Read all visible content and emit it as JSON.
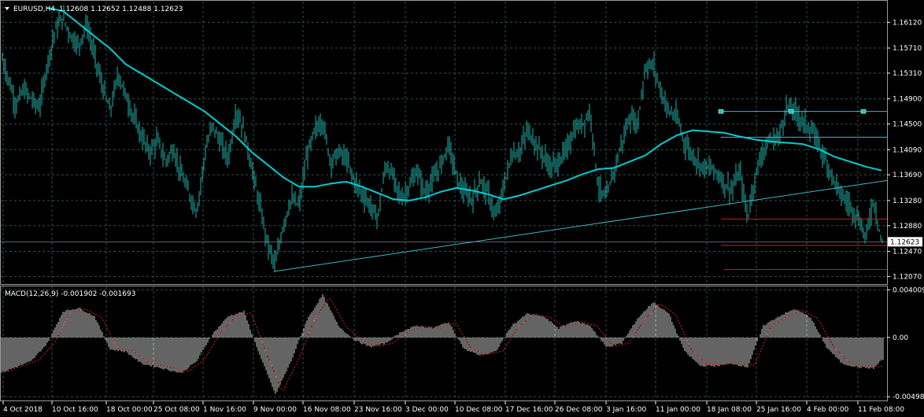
{
  "header": {
    "symbol": "EURUSD,H4",
    "ohlc": "1.12608 1.12652 1.12488 1.12623"
  },
  "macd_header": {
    "label": "MACD(12,26,9) -0.001902 -0.001693"
  },
  "colors": {
    "background": "#000000",
    "grid": "#2f4f4f",
    "bar": "#20b2aa",
    "ma": "#00ced1",
    "trendline": "#3fb7c7",
    "hline_red": "#c81e1e",
    "macd_hist": "#c8c8c8",
    "signal": "#e02020",
    "text": "#ffffff"
  },
  "chart_data": [
    {
      "type": "candlestick",
      "title": "EURUSD,H4",
      "y_ticks": [
        "1.16120",
        "1.15710",
        "1.15310",
        "1.14900",
        "1.14500",
        "1.14090",
        "1.13690",
        "1.13280",
        "1.12880",
        "1.12470",
        "1.12070"
      ],
      "ylim": [
        1.1195,
        1.1645
      ],
      "current_price": "1.12623",
      "x_ticks": [
        "4 Oct 2018",
        "10 Oct 16:00",
        "18 Oct 00:00",
        "25 Oct 08:00",
        "1 Nov 16:00",
        "9 Nov 00:00",
        "16 Nov 08:00",
        "23 Nov 16:00",
        "3 Dec 00:00",
        "10 Dec 08:00",
        "17 Dec 16:00",
        "26 Dec 08:00",
        "3 Jan 16:00",
        "11 Jan 00:00",
        "18 Jan 08:00",
        "25 Jan 16:00",
        "4 Feb 00:00",
        "11 Feb 08:00"
      ],
      "close_path": [
        [
          0,
          1.1565
        ],
        [
          10,
          1.1525
        ],
        [
          20,
          1.148
        ],
        [
          30,
          1.1505
        ],
        [
          40,
          1.149
        ],
        [
          50,
          1.1475
        ],
        [
          60,
          1.1545
        ],
        [
          70,
          1.16
        ],
        [
          80,
          1.162
        ],
        [
          90,
          1.159
        ],
        [
          100,
          1.1575
        ],
        [
          110,
          1.161
        ],
        [
          120,
          1.156
        ],
        [
          130,
          1.151
        ],
        [
          140,
          1.147
        ],
        [
          150,
          1.153
        ],
        [
          160,
          1.1495
        ],
        [
          170,
          1.146
        ],
        [
          180,
          1.143
        ],
        [
          190,
          1.1405
        ],
        [
          200,
          1.1425
        ],
        [
          210,
          1.139
        ],
        [
          220,
          1.141
        ],
        [
          230,
          1.137
        ],
        [
          240,
          1.134
        ],
        [
          250,
          1.131
        ],
        [
          260,
          1.14
        ],
        [
          270,
          1.145
        ],
        [
          280,
          1.142
        ],
        [
          290,
          1.1395
        ],
        [
          300,
          1.147
        ],
        [
          310,
          1.144
        ],
        [
          320,
          1.138
        ],
        [
          330,
          1.132
        ],
        [
          340,
          1.126
        ],
        [
          350,
          1.1225
        ],
        [
          360,
          1.129
        ],
        [
          370,
          1.133
        ],
        [
          380,
          1.132
        ],
        [
          390,
          1.14
        ],
        [
          400,
          1.144
        ],
        [
          410,
          1.1455
        ],
        [
          420,
          1.139
        ],
        [
          430,
          1.1405
        ],
        [
          440,
          1.1395
        ],
        [
          450,
          1.136
        ],
        [
          460,
          1.134
        ],
        [
          470,
          1.132
        ],
        [
          480,
          1.13
        ],
        [
          490,
          1.1385
        ],
        [
          500,
          1.1365
        ],
        [
          510,
          1.133
        ],
        [
          520,
          1.135
        ],
        [
          530,
          1.1375
        ],
        [
          540,
          1.134
        ],
        [
          550,
          1.136
        ],
        [
          560,
          1.1385
        ],
        [
          570,
          1.142
        ],
        [
          580,
          1.1365
        ],
        [
          590,
          1.134
        ],
        [
          600,
          1.133
        ],
        [
          610,
          1.136
        ],
        [
          620,
          1.134
        ],
        [
          630,
          1.13
        ],
        [
          640,
          1.135
        ],
        [
          650,
          1.14
        ],
        [
          660,
          1.1405
        ],
        [
          670,
          1.144
        ],
        [
          680,
          1.142
        ],
        [
          690,
          1.14
        ],
        [
          700,
          1.138
        ],
        [
          710,
          1.139
        ],
        [
          720,
          1.141
        ],
        [
          730,
          1.144
        ],
        [
          740,
          1.145
        ],
        [
          750,
          1.147
        ],
        [
          760,
          1.135
        ],
        [
          770,
          1.133
        ],
        [
          780,
          1.1375
        ],
        [
          790,
          1.142
        ],
        [
          800,
          1.146
        ],
        [
          810,
          1.145
        ],
        [
          820,
          1.154
        ],
        [
          830,
          1.1545
        ],
        [
          840,
          1.15
        ],
        [
          850,
          1.147
        ],
        [
          860,
          1.146
        ],
        [
          870,
          1.142
        ],
        [
          880,
          1.14
        ],
        [
          890,
          1.1385
        ],
        [
          900,
          1.138
        ],
        [
          910,
          1.1375
        ],
        [
          920,
          1.1355
        ],
        [
          930,
          1.1345
        ],
        [
          940,
          1.1375
        ],
        [
          950,
          1.13
        ],
        [
          960,
          1.137
        ],
        [
          970,
          1.141
        ],
        [
          980,
          1.1425
        ],
        [
          990,
          1.143
        ],
        [
          1000,
          1.148
        ],
        [
          1010,
          1.147
        ],
        [
          1020,
          1.1455
        ],
        [
          1030,
          1.144
        ],
        [
          1040,
          1.142
        ],
        [
          1050,
          1.139
        ],
        [
          1060,
          1.136
        ],
        [
          1070,
          1.1335
        ],
        [
          1080,
          1.132
        ],
        [
          1090,
          1.13
        ],
        [
          1100,
          1.127
        ],
        [
          1110,
          1.133
        ],
        [
          1120,
          1.1262
        ]
      ],
      "ma_path": [
        [
          60,
          1.1635
        ],
        [
          80,
          1.163
        ],
        [
          100,
          1.161
        ],
        [
          120,
          1.159
        ],
        [
          140,
          1.157
        ],
        [
          160,
          1.1545
        ],
        [
          180,
          1.153
        ],
        [
          200,
          1.1515
        ],
        [
          220,
          1.15
        ],
        [
          240,
          1.1485
        ],
        [
          260,
          1.147
        ],
        [
          280,
          1.145
        ],
        [
          300,
          1.143
        ],
        [
          320,
          1.1405
        ],
        [
          340,
          1.1385
        ],
        [
          360,
          1.1365
        ],
        [
          380,
          1.135
        ],
        [
          400,
          1.135
        ],
        [
          420,
          1.1355
        ],
        [
          440,
          1.1358
        ],
        [
          460,
          1.135
        ],
        [
          480,
          1.134
        ],
        [
          500,
          1.133
        ],
        [
          520,
          1.1328
        ],
        [
          540,
          1.1333
        ],
        [
          560,
          1.1342
        ],
        [
          580,
          1.1348
        ],
        [
          600,
          1.1344
        ],
        [
          620,
          1.1338
        ],
        [
          640,
          1.133
        ],
        [
          660,
          1.1336
        ],
        [
          680,
          1.1344
        ],
        [
          700,
          1.1352
        ],
        [
          720,
          1.136
        ],
        [
          740,
          1.137
        ],
        [
          760,
          1.1378
        ],
        [
          780,
          1.138
        ],
        [
          800,
          1.139
        ],
        [
          820,
          1.14
        ],
        [
          840,
          1.1418
        ],
        [
          860,
          1.1432
        ],
        [
          880,
          1.144
        ],
        [
          900,
          1.1438
        ],
        [
          920,
          1.1436
        ],
        [
          940,
          1.143
        ],
        [
          960,
          1.1425
        ],
        [
          980,
          1.1422
        ],
        [
          1000,
          1.142
        ],
        [
          1020,
          1.1418
        ],
        [
          1040,
          1.141
        ],
        [
          1060,
          1.1398
        ],
        [
          1080,
          1.139
        ],
        [
          1100,
          1.1382
        ],
        [
          1120,
          1.1376
        ]
      ],
      "trendline": [
        [
          348,
          1.1215
        ],
        [
          1127,
          1.136
        ]
      ],
      "hlines": [
        {
          "price": 1.147,
          "from": 916,
          "to": 1127,
          "color": "cyan",
          "markers": [
            916,
            1005,
            1097
          ]
        },
        {
          "price": 1.1429,
          "from": 916,
          "to": 1127,
          "color": "cyan"
        },
        {
          "price": 1.12985,
          "from": 916,
          "to": 1127,
          "color": "red"
        },
        {
          "price": 1.12565,
          "from": 916,
          "to": 1127,
          "color": "red"
        },
        {
          "price": 1.1218,
          "from": 920,
          "to": 1127,
          "color": "red"
        },
        {
          "price": 1.12623,
          "from": 0,
          "to": 1127,
          "color": "gray"
        }
      ]
    },
    {
      "type": "histogram",
      "title": "MACD(12,26,9)",
      "macd_value": "-0.001902",
      "signal_value": "-0.001693",
      "y_ticks": [
        "0.004009",
        "0.00",
        "-0.004982"
      ],
      "ylim": [
        -0.0053,
        0.0043
      ],
      "hist_path": [
        [
          0,
          -0.003
        ],
        [
          20,
          -0.0025
        ],
        [
          40,
          -0.002
        ],
        [
          60,
          -0.0005
        ],
        [
          80,
          0.0022
        ],
        [
          100,
          0.0025
        ],
        [
          120,
          0.0018
        ],
        [
          140,
          -0.001
        ],
        [
          160,
          -0.0012
        ],
        [
          180,
          -0.0022
        ],
        [
          200,
          -0.0025
        ],
        [
          230,
          -0.003
        ],
        [
          250,
          -0.002
        ],
        [
          270,
          0.0003
        ],
        [
          290,
          0.0018
        ],
        [
          310,
          0.0022
        ],
        [
          330,
          -0.0015
        ],
        [
          350,
          -0.0048
        ],
        [
          370,
          -0.002
        ],
        [
          390,
          0.0015
        ],
        [
          410,
          0.0036
        ],
        [
          430,
          0.001
        ],
        [
          450,
          -0.0002
        ],
        [
          470,
          -0.0008
        ],
        [
          490,
          -0.0005
        ],
        [
          510,
          0.0005
        ],
        [
          530,
          0.001
        ],
        [
          550,
          0.0008
        ],
        [
          570,
          0.0013
        ],
        [
          590,
          -0.001
        ],
        [
          610,
          -0.0015
        ],
        [
          630,
          -0.0012
        ],
        [
          650,
          0.001
        ],
        [
          670,
          0.002
        ],
        [
          690,
          0.0018
        ],
        [
          710,
          0.0008
        ],
        [
          730,
          0.0014
        ],
        [
          750,
          0.001
        ],
        [
          770,
          -0.0008
        ],
        [
          790,
          -0.0005
        ],
        [
          810,
          0.0016
        ],
        [
          830,
          0.003
        ],
        [
          850,
          0.002
        ],
        [
          870,
          -0.0012
        ],
        [
          890,
          -0.0024
        ],
        [
          910,
          -0.0024
        ],
        [
          930,
          -0.0022
        ],
        [
          950,
          -0.0025
        ],
        [
          970,
          0.001
        ],
        [
          990,
          0.0018
        ],
        [
          1010,
          0.0024
        ],
        [
          1030,
          0.0017
        ],
        [
          1050,
          -0.0008
        ],
        [
          1070,
          -0.0022
        ],
        [
          1090,
          -0.0025
        ],
        [
          1110,
          -0.0026
        ],
        [
          1120,
          -0.0019
        ]
      ]
    }
  ]
}
